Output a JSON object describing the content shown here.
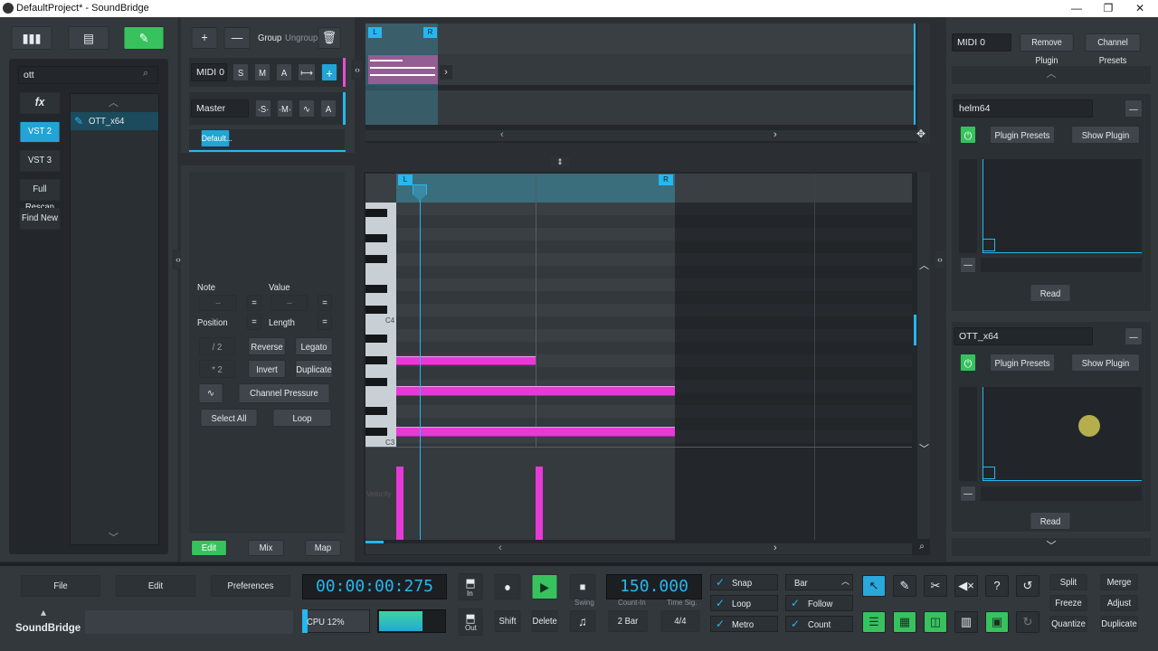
{
  "window": {
    "title": "DefaultProject* - SoundBridge",
    "minimize": "—",
    "maximize": "❐",
    "close": "✕"
  },
  "browser": {
    "search_value": "ott",
    "fx_label": "fx",
    "filters": [
      "VST 2",
      "VST 3",
      "Full Rescan",
      "Find New"
    ],
    "result": "OTT_x64"
  },
  "tracks": {
    "add": "+",
    "remove": "—",
    "group": "Group",
    "ungroup": "Ungroup",
    "midi_name": "MIDI 0",
    "master_name": "Master",
    "s": "S",
    "m": "M",
    "a": "A",
    "ms": "·S·",
    "mm": "·M·",
    "tab": "Default...",
    "arrow": "›"
  },
  "editor": {
    "note_label": "Note",
    "value_label": "Value",
    "position_label": "Position",
    "length_label": "Length",
    "div2": "/ 2",
    "mul2": "* 2",
    "reverse": "Reverse",
    "legato": "Legato",
    "invert": "Invert",
    "duplicate": "Duplicate",
    "channel_pressure": "Channel Pressure",
    "select_all": "Select All",
    "loop": "Loop",
    "note_val": "--",
    "value_val": "--",
    "c4": "C4",
    "c3": "C3",
    "velocity": "Velocity"
  },
  "views": {
    "edit": "Edit",
    "mix": "Mix",
    "map": "Map"
  },
  "marker": {
    "l": "L",
    "r": "R"
  },
  "plugins": {
    "midi_name": "MIDI 0",
    "remove_plugin": "Remove Plugin",
    "channel_presets": "Channel Presets",
    "items": [
      {
        "name": "helm64",
        "presets": "Plugin Presets",
        "show": "Show Plugin",
        "read": "Read"
      },
      {
        "name": "OTT_x64",
        "presets": "Plugin Presets",
        "show": "Show Plugin",
        "read": "Read"
      }
    ]
  },
  "transport": {
    "file": "File",
    "edit": "Edit",
    "preferences": "Preferences",
    "time": "00:00:00:275",
    "tempo": "150.000",
    "in": "In",
    "out": "Out",
    "shift": "Shift",
    "delete": "Delete",
    "swing": "Swing",
    "count_in_label": "Count-In",
    "count_in": "2 Bar",
    "time_sig_label": "Time Sig.",
    "time_sig": "4/4",
    "cpu": "CPU 12%",
    "snap": "Snap",
    "loop": "Loop",
    "metro": "Metro",
    "bar": "Bar",
    "follow": "Follow",
    "count": "Count",
    "split": "Split",
    "merge": "Merge",
    "freeze": "Freeze",
    "adjust": "Adjust",
    "quantize": "Quantize",
    "duplicate": "Duplicate",
    "logo": "SoundBridge"
  }
}
